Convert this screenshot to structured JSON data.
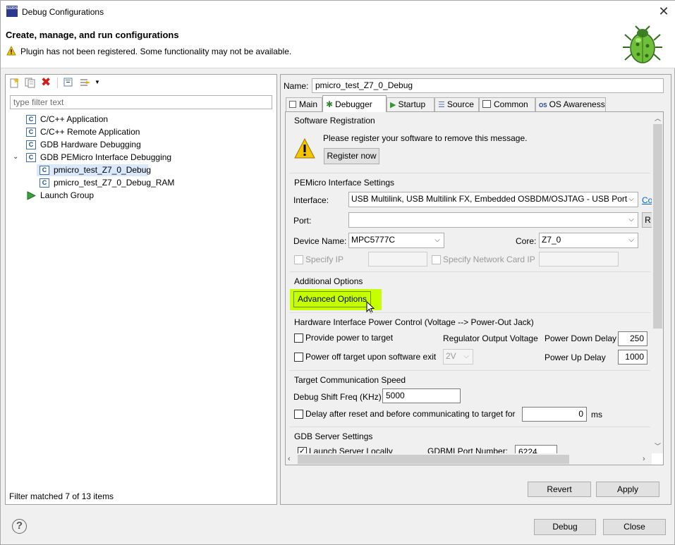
{
  "window": {
    "title": "Debug Configurations",
    "icon_text": "S32DS"
  },
  "header": {
    "title": "Create, manage, and run configurations",
    "warning": "Plugin has not been registered. Some functionality may not be available."
  },
  "left": {
    "filter_placeholder": "type filter text",
    "tree": [
      {
        "label": "C/C++ Application"
      },
      {
        "label": "C/C++ Remote Application"
      },
      {
        "label": "GDB Hardware Debugging"
      },
      {
        "label": "GDB PEMicro Interface Debugging"
      },
      {
        "label": "pmicro_test_Z7_0_Debug"
      },
      {
        "label": "pmicro_test_Z7_0_Debug_RAM"
      },
      {
        "label": "Launch Group"
      }
    ],
    "status": "Filter matched 7 of 13 items"
  },
  "right": {
    "name_label": "Name:",
    "name_value": "pmicro_test_Z7_0_Debug",
    "tabs": [
      "Main",
      "Debugger",
      "Startup",
      "Source",
      "Common",
      "OS Awareness"
    ],
    "sw_reg": {
      "title": "Software Registration",
      "message": "Please register your software to remove this message.",
      "button": "Register now"
    },
    "pemicro": {
      "title": "PEMicro Interface Settings",
      "interface_label": "Interface:",
      "interface_value": "USB Multilink, USB Multilink FX, Embedded OSBDM/OSJTAG - USB Port",
      "interface_link": "Co",
      "port_label": "Port:",
      "port_value": "",
      "port_button": "R",
      "device_label": "Device Name:",
      "device_value": "MPC5777C",
      "core_label": "Core:",
      "core_value": "Z7_0",
      "specify_ip": "Specify IP",
      "specify_nc": "Specify Network Card IP"
    },
    "additional": {
      "title": "Additional Options",
      "button": "Advanced Options"
    },
    "power": {
      "title": "Hardware Interface Power Control (Voltage --> Power-Out Jack)",
      "provide": "Provide power to target",
      "reg_label": "Regulator Output Voltage",
      "down_label": "Power Down Delay",
      "down_value": "250",
      "poweroff": "Power off target upon software exit",
      "voltage": "2V",
      "up_label": "Power Up Delay",
      "up_value": "1000"
    },
    "speed": {
      "title": "Target Communication Speed",
      "shift_label": "Debug Shift Freq (KHz)",
      "shift_value": "5000",
      "delay_label": "Delay after reset and before communicating to target for",
      "delay_value": "0",
      "delay_unit": "ms"
    },
    "gdb": {
      "title": "GDB Server Settings",
      "launch": "Launch Server Locally",
      "port_label": "GDBMI Port Number:",
      "port_value": "6224"
    },
    "revert": "Revert",
    "apply": "Apply"
  },
  "footer": {
    "help": "?",
    "debug": "Debug",
    "close": "Close"
  },
  "colors": {
    "highlight": "#c6ff00",
    "selection": "#d9e8fb"
  }
}
